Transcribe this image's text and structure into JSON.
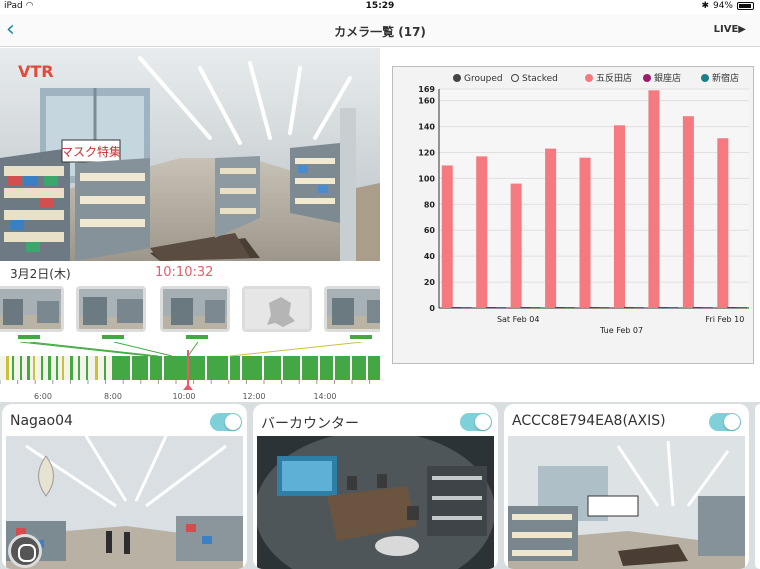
{
  "status_bar": {
    "device": "iPad",
    "time": "15:29",
    "battery": "94%",
    "battery_level": 0.94
  },
  "nav": {
    "title": "カメラ一覧 (17)",
    "live_label": "LIVE▶"
  },
  "player": {
    "mode_badge": "VTR",
    "date": "3月2日(木)",
    "current_time": "10:10:32",
    "timeline_ticks": [
      "6:00",
      "8:00",
      "10:00",
      "12:00",
      "14:00"
    ]
  },
  "chart_data": {
    "type": "bar",
    "controls": [
      "Grouped",
      "Stacked"
    ],
    "selected_control": "Grouped",
    "series": [
      {
        "name": "五反田店",
        "color": "#f47a80",
        "values": [
          110,
          117,
          96,
          123,
          116,
          141,
          168,
          148,
          131
        ]
      },
      {
        "name": "銀座店",
        "color": "#9c1c6b",
        "values": [
          0,
          0,
          0,
          0,
          0,
          0,
          0,
          0,
          0
        ]
      },
      {
        "name": "新宿店",
        "color": "#1c7f8c",
        "values": [
          0,
          0,
          0,
          0,
          0,
          0,
          0,
          0,
          0
        ]
      }
    ],
    "x_tick_labels": [
      "Sat Feb 04",
      "Tue Feb 07",
      "Fri Feb 10"
    ],
    "y_ticks": [
      0,
      20,
      40,
      60,
      80,
      100,
      120,
      140,
      160,
      169
    ],
    "ylim": [
      0,
      169
    ],
    "grid": true,
    "legend_position": "top"
  },
  "cameras": [
    {
      "name": "Nagao04",
      "enabled": true
    },
    {
      "name": "バーカウンター",
      "enabled": true
    },
    {
      "name": "ACCC8E794EA8(AXIS)",
      "enabled": true
    }
  ],
  "colors": {
    "accent": "#1a8aa5",
    "timeline_green": "#43a843",
    "playhead": "#e35d6a",
    "toggle": "#7fd0d8"
  }
}
